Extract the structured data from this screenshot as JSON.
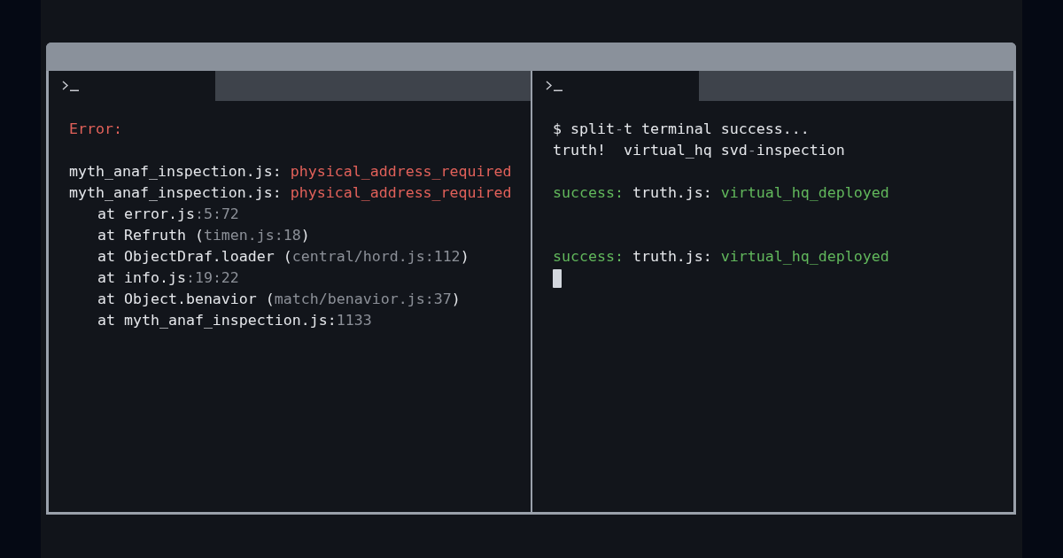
{
  "window": {
    "panes": [
      {
        "tabs": [
          {
            "selected": true
          }
        ],
        "lines": [
          {
            "kind": "output",
            "segments": [
              {
                "text": "Error:",
                "kind": "error"
              }
            ]
          },
          {
            "kind": "blank"
          },
          {
            "kind": "output",
            "segments": [
              {
                "text": "myth_anaf_inspection.js: ",
                "kind": "plain"
              },
              {
                "text": "physical_address_required",
                "kind": "error"
              }
            ]
          },
          {
            "kind": "output",
            "segments": [
              {
                "text": "myth_anaf_inspection.js: ",
                "kind": "plain"
              },
              {
                "text": "physical_address_required",
                "kind": "error"
              }
            ],
            "children": [
              {
                "kind": "output",
                "segments": [
                  {
                    "text": "at error.js",
                    "kind": "plain"
                  },
                  {
                    "text": ":5:72",
                    "kind": "dim"
                  }
                ]
              },
              {
                "kind": "output",
                "segments": [
                  {
                    "text": "at Refruth (",
                    "kind": "plain"
                  },
                  {
                    "text": "timen.js:18",
                    "kind": "dim"
                  },
                  {
                    "text": ")",
                    "kind": "plain"
                  }
                ]
              },
              {
                "kind": "output",
                "segments": [
                  {
                    "text": "at ObjectDraf.loader (",
                    "kind": "plain"
                  },
                  {
                    "text": "central/hord.js:112",
                    "kind": "dim"
                  },
                  {
                    "text": ")",
                    "kind": "plain"
                  }
                ]
              },
              {
                "kind": "output",
                "segments": [
                  {
                    "text": "at info.js",
                    "kind": "plain"
                  },
                  {
                    "text": ":19:22",
                    "kind": "dim"
                  }
                ]
              },
              {
                "kind": "output",
                "segments": [
                  {
                    "text": "at Object.benavior (",
                    "kind": "plain"
                  },
                  {
                    "text": "match/benavior.js:37",
                    "kind": "dim"
                  },
                  {
                    "text": ")",
                    "kind": "plain"
                  }
                ]
              },
              {
                "kind": "output",
                "segments": [
                  {
                    "text": "at myth_anaf_inspection.js:",
                    "kind": "plain"
                  },
                  {
                    "text": "1133",
                    "kind": "dim"
                  }
                ]
              }
            ]
          }
        ]
      },
      {
        "tabs": [
          {
            "selected": true
          }
        ],
        "lines": [
          {
            "kind": "command",
            "segments": [
              {
                "text": "$ split",
                "kind": "plain"
              },
              {
                "text": "-",
                "kind": "dim"
              },
              {
                "text": "t terminal success...",
                "kind": "plain"
              }
            ]
          },
          {
            "kind": "output",
            "segments": [
              {
                "text": "truth!  virtual_hq svd",
                "kind": "plain"
              },
              {
                "text": "-",
                "kind": "dim"
              },
              {
                "text": "inspection",
                "kind": "plain"
              }
            ]
          },
          {
            "kind": "blank"
          },
          {
            "kind": "output",
            "segments": [
              {
                "text": "success: ",
                "kind": "success"
              },
              {
                "text": "truth.js: ",
                "kind": "plain"
              },
              {
                "text": "virtual_hq_deployed",
                "kind": "success"
              }
            ]
          },
          {
            "kind": "blank"
          },
          {
            "kind": "blank"
          },
          {
            "kind": "output",
            "segments": [
              {
                "text": "success: ",
                "kind": "success"
              },
              {
                "text": "truth.js: ",
                "kind": "plain"
              },
              {
                "text": "virtual_hq_deployed",
                "kind": "success"
              }
            ]
          },
          {
            "kind": "cursor"
          }
        ]
      }
    ]
  }
}
